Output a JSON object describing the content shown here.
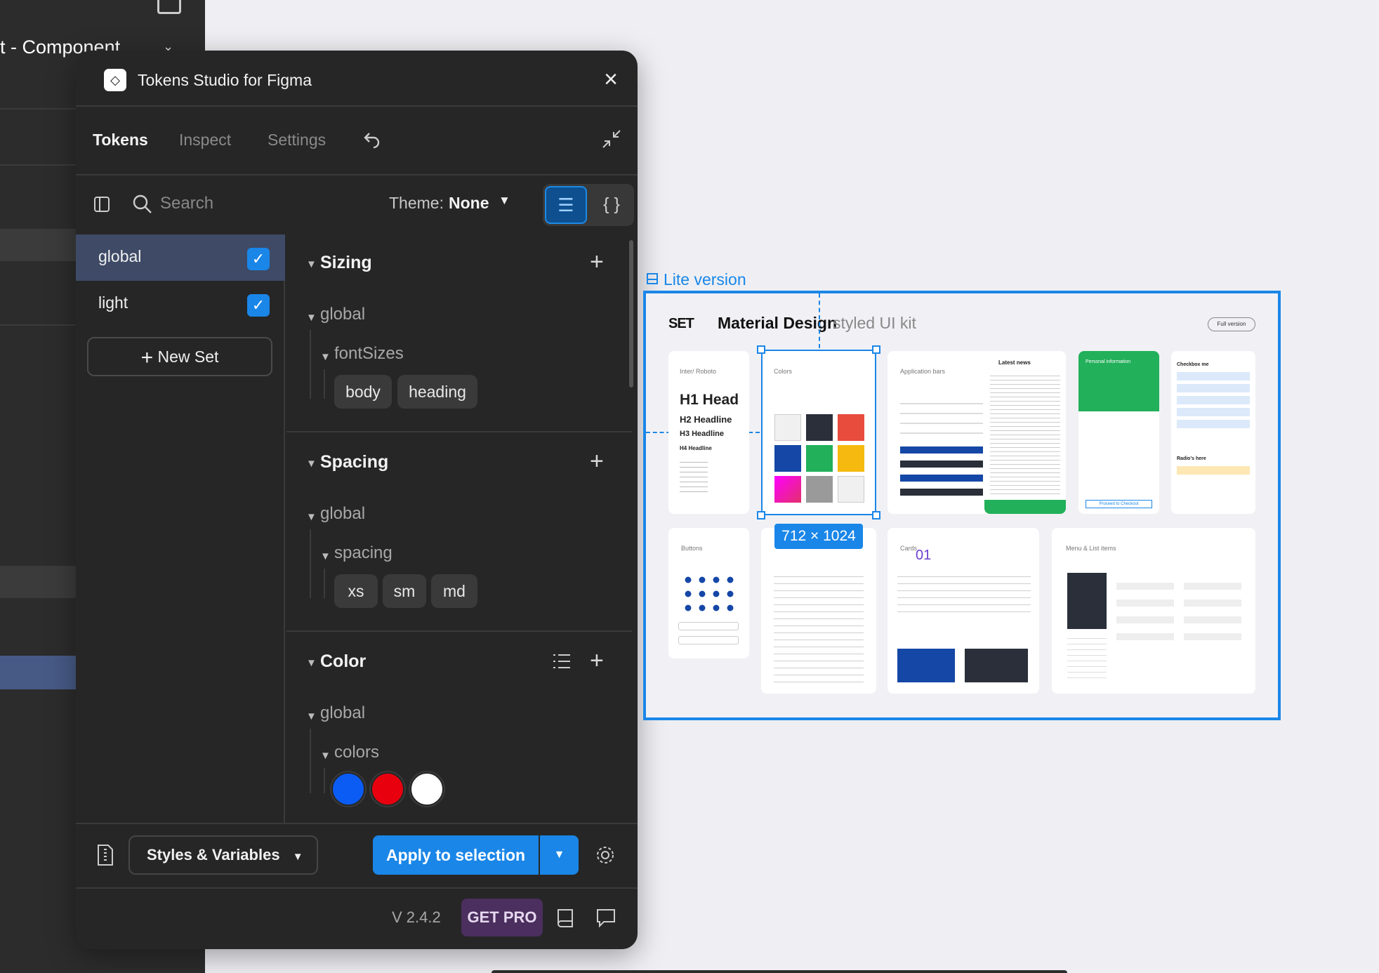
{
  "figma": {
    "file_title": "t - Component"
  },
  "plugin": {
    "title": "Tokens Studio for Figma",
    "tabs": [
      {
        "label": "Tokens",
        "active": true
      },
      {
        "label": "Inspect",
        "active": false
      },
      {
        "label": "Settings",
        "active": false
      }
    ],
    "search": {
      "placeholder": "Search"
    },
    "theme": {
      "label": "Theme:",
      "value": "None"
    },
    "sets": [
      {
        "label": "global",
        "checked": true,
        "active": true
      },
      {
        "label": "light",
        "checked": true,
        "active": false
      }
    ],
    "new_set_label": "New Set",
    "groups": {
      "sizing": {
        "title": "Sizing",
        "set": "global",
        "subgroup": "fontSizes",
        "tokens": [
          "body",
          "heading"
        ]
      },
      "spacing": {
        "title": "Spacing",
        "set": "global",
        "subgroup": "spacing",
        "tokens": [
          "xs",
          "sm",
          "md"
        ]
      },
      "color": {
        "title": "Color",
        "set": "global",
        "subgroup": "colors",
        "swatches": [
          "#0a5cf5",
          "#e8000f",
          "#ffffff"
        ]
      }
    },
    "footer": {
      "styles_label": "Styles & Variables",
      "apply_label": "Apply to selection",
      "version": "V 2.4.2",
      "get_pro": "GET PRO"
    }
  },
  "canvas": {
    "frame_label": "Lite version",
    "frame_title": "Material Design",
    "frame_title_sub": "styled UI kit",
    "full_version": "Full version",
    "selection_size": "712 × 1024",
    "cards": {
      "typography_label": "Inter/ Roboto",
      "h1": "H1 Head",
      "h2": "H2 Headline",
      "h3": "H3 Headline",
      "h4": "H4 Headline",
      "colors": "Colors",
      "app_bars": "Application bars",
      "latest_news": "Latest news",
      "personal_info": "Personal information",
      "checkout": "Proceed to Checkout",
      "checkbox_me": "Checkbox me",
      "radios": "Radio's here",
      "buttons": "Buttons",
      "cards": "Cards",
      "cards_num": "01",
      "menu_list": "Menu & List items"
    }
  },
  "colors": {
    "accent": "#1a86e8",
    "pro": "#4b2f5e"
  }
}
